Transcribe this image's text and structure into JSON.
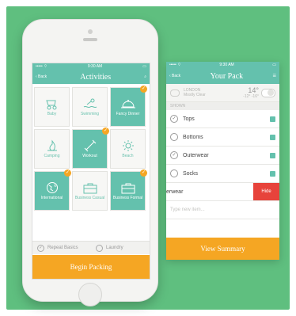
{
  "colors": {
    "background": "#5fbf7f",
    "teal": "#64c1ad",
    "orange": "#f5a623",
    "hide_red": "#e7433b"
  },
  "activities_screen": {
    "status": {
      "left": "••••• ⌔",
      "center": "9:30 AM",
      "right": "▭"
    },
    "nav": {
      "back": "‹ Back",
      "title": "Activities",
      "icon": "search-icon"
    },
    "tiles": [
      {
        "label": "Baby",
        "icon": "stroller-icon",
        "selected": false,
        "checked": false
      },
      {
        "label": "Swimming",
        "icon": "swimmer-icon",
        "selected": false,
        "checked": false
      },
      {
        "label": "Fancy Dinner",
        "icon": "cloche-icon",
        "selected": true,
        "checked": true
      },
      {
        "label": "Camping",
        "icon": "campfire-icon",
        "selected": false,
        "checked": false
      },
      {
        "label": "Workout",
        "icon": "dumbbell-icon",
        "selected": true,
        "checked": true
      },
      {
        "label": "Beach",
        "icon": "sun-icon",
        "selected": false,
        "checked": false
      },
      {
        "label": "International",
        "icon": "globe-icon",
        "selected": true,
        "checked": true
      },
      {
        "label": "Business Casual",
        "icon": "briefcase-icon",
        "selected": false,
        "checked": false
      },
      {
        "label": "Business Formal",
        "icon": "briefcase-icon",
        "selected": true,
        "checked": true
      }
    ],
    "repeat_basics": "Repeat Basics",
    "laundry": "Laundry",
    "begin_button": "Begin Packing"
  },
  "pack_screen": {
    "status": {
      "left": "••••• ⌔",
      "center": "9:30 AM",
      "right": "▭"
    },
    "nav": {
      "back": "‹ Back",
      "title": "Your Pack",
      "icon": "menu-icon"
    },
    "weather": {
      "city": "LONDON",
      "desc": "Mostly Clear",
      "temp": "14°",
      "range": "-12° -16°"
    },
    "section": "SHOWN",
    "items": [
      {
        "label": "Tops",
        "checked": true
      },
      {
        "label": "Bottoms",
        "checked": false
      },
      {
        "label": "Outerwear",
        "checked": true
      },
      {
        "label": "Socks",
        "checked": false
      }
    ],
    "swipe_item": "erwear",
    "hide_label": "Hide",
    "new_item_placeholder": "Type new item...",
    "summary_button": "View Summary"
  }
}
